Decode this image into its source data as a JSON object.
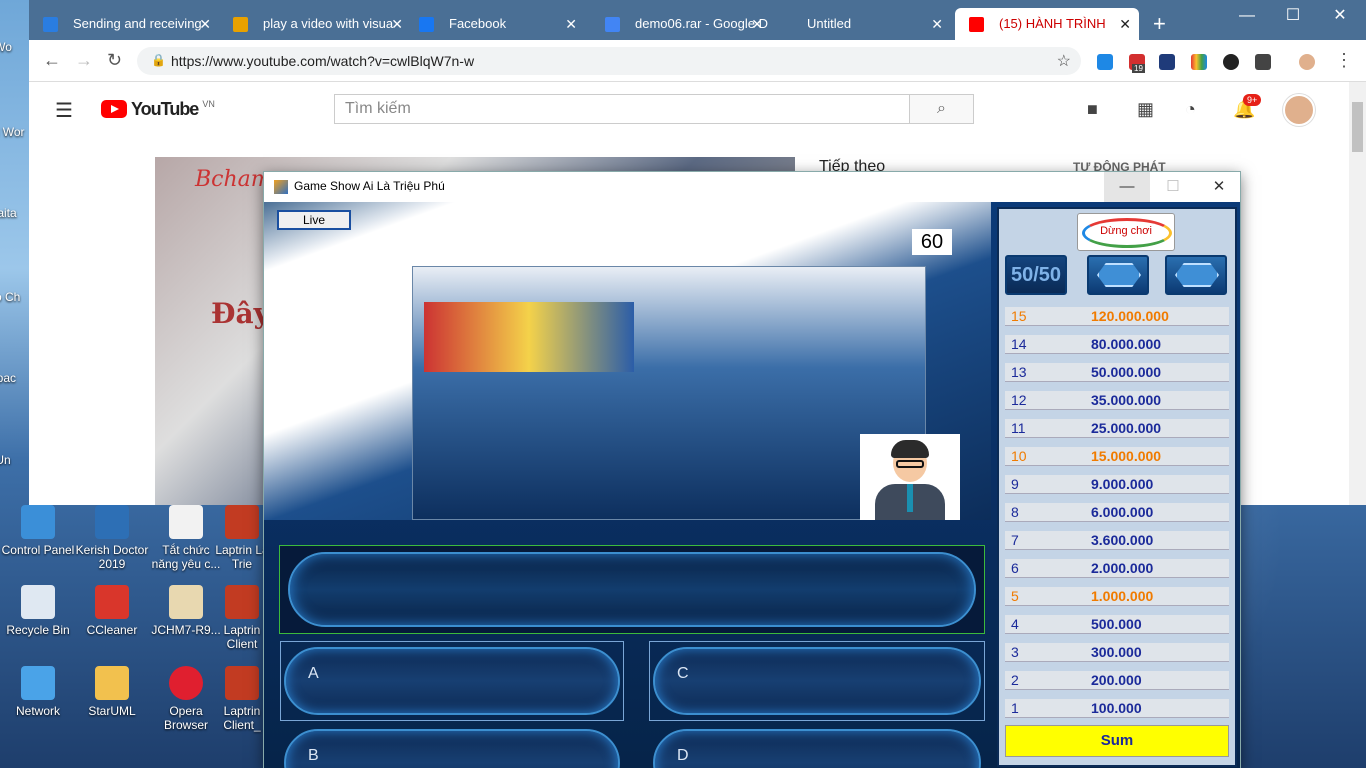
{
  "browser": {
    "tabs": [
      {
        "title": "Sending and receiving",
        "favicon_color": "#2a7de1"
      },
      {
        "title": "play a video with visua",
        "favicon_color": "#e8a100"
      },
      {
        "title": "Facebook",
        "favicon_color": "#1877f2"
      },
      {
        "title": "demo06.rar - Google D",
        "favicon_color": "#4285f4"
      },
      {
        "title": "Untitled",
        "favicon_color": ""
      },
      {
        "title": "(15) HÀNH TRÌNH",
        "favicon_color": "#ff0000"
      }
    ],
    "new_tab_label": "+",
    "url": "https://www.youtube.com/watch?v=cwlBlqW7n-w",
    "window_controls": {
      "minimize": "—",
      "maximize": "☐",
      "close": "✕"
    },
    "extension_badge": "19"
  },
  "youtube": {
    "logo_text": "YouTube",
    "logo_country": "VN",
    "search_placeholder": "Tìm kiếm",
    "notif_count": "9+",
    "up_next": "Tiếp theo",
    "autoplay": "TỰ ĐỘNG PHÁT",
    "video_brand": "Bchamn",
    "video_caption": "Đây"
  },
  "desktop_icons": [
    "Control Panel",
    "Kerish Doctor 2019",
    "Tắt chức năng yêu c...",
    "Laptrin La Trie",
    "Recycle Bin",
    "CCleaner",
    "JCHM7-R9...",
    "Laptrin Client",
    "Network",
    "StarUML",
    "Opera Browser",
    "Laptrin Client_"
  ],
  "desktop_left_labels": [
    "Wo",
    "VM Wor",
    "Baita",
    "Go Ch",
    "apac",
    "Un"
  ],
  "game": {
    "window_title": "Game Show Ai Là Triệu Phú",
    "live_label": "Live",
    "timer": "60",
    "stop_label": "Dừng chơi",
    "fifty_label": "50/50",
    "answers": [
      "A",
      "C",
      "B",
      "D"
    ],
    "sum_label": "Sum",
    "prizes": [
      {
        "level": "15",
        "amount": "120.000.000",
        "milestone": true
      },
      {
        "level": "14",
        "amount": "80.000.000",
        "milestone": false
      },
      {
        "level": "13",
        "amount": "50.000.000",
        "milestone": false
      },
      {
        "level": "12",
        "amount": "35.000.000",
        "milestone": false
      },
      {
        "level": "11",
        "amount": "25.000.000",
        "milestone": false
      },
      {
        "level": "10",
        "amount": "15.000.000",
        "milestone": true
      },
      {
        "level": "9",
        "amount": "9.000.000",
        "milestone": false
      },
      {
        "level": "8",
        "amount": "6.000.000",
        "milestone": false
      },
      {
        "level": "7",
        "amount": "3.600.000",
        "milestone": false
      },
      {
        "level": "6",
        "amount": "2.000.000",
        "milestone": false
      },
      {
        "level": "5",
        "amount": "1.000.000",
        "milestone": true
      },
      {
        "level": "4",
        "amount": "500.000",
        "milestone": false
      },
      {
        "level": "3",
        "amount": "300.000",
        "milestone": false
      },
      {
        "level": "2",
        "amount": "200.000",
        "milestone": false
      },
      {
        "level": "1",
        "amount": "100.000",
        "milestone": false
      }
    ]
  }
}
